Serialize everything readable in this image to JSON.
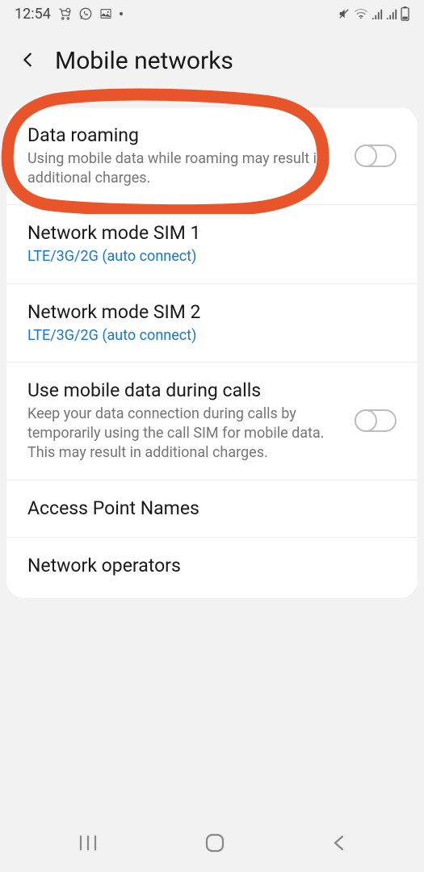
{
  "status": {
    "time": "12:54"
  },
  "header": {
    "title": "Mobile networks"
  },
  "rows": {
    "roaming": {
      "title": "Data roaming",
      "subtitle": "Using mobile data while roaming may result in additional charges."
    },
    "sim1": {
      "title": "Network mode SIM 1",
      "subtitle": "LTE/3G/2G (auto connect)"
    },
    "sim2": {
      "title": "Network mode SIM 2",
      "subtitle": "LTE/3G/2G (auto connect)"
    },
    "calls": {
      "title": "Use mobile data during calls",
      "subtitle": "Keep your data connection during calls by temporarily using the call SIM for mobile data. This may result in additional charges."
    },
    "apn": {
      "title": "Access Point Names"
    },
    "operators": {
      "title": "Network operators"
    }
  }
}
